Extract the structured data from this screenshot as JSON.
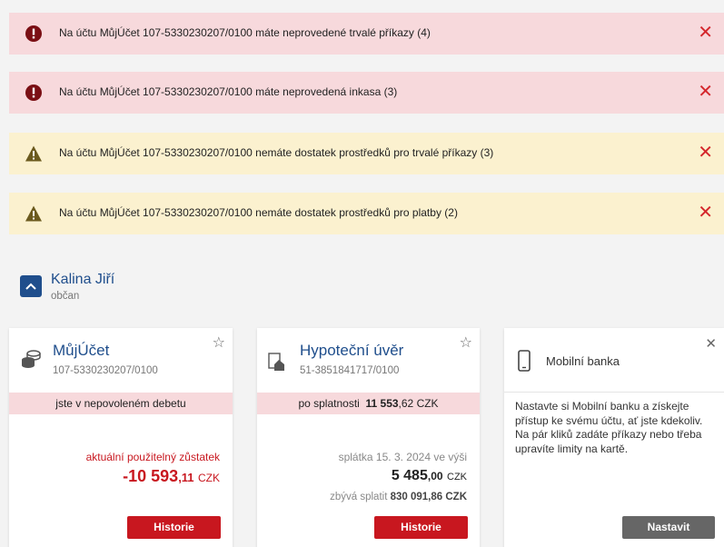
{
  "alerts": [
    {
      "type": "error",
      "text": "Na účtu MůjÚčet 107-5330230207/0100 máte neprovedené trvalé příkazy (4)"
    },
    {
      "type": "error",
      "text": "Na účtu MůjÚčet 107-5330230207/0100 máte neprovedená inkasa (3)"
    },
    {
      "type": "warning",
      "text": "Na účtu MůjÚčet 107-5330230207/0100 nemáte dostatek prostředků pro trvalé příkazy (3)"
    },
    {
      "type": "warning",
      "text": "Na účtu MůjÚčet 107-5330230207/0100 nemáte dostatek prostředků pro platby (2)"
    }
  ],
  "close_symbol": "✕",
  "client": {
    "name": "Kalina Jiří",
    "role": "občan"
  },
  "cards": {
    "account": {
      "title": "MůjÚčet",
      "number": "107-5330230207/0100",
      "band": "jste v nepovoleném debetu",
      "balance_label": "aktuální použitelný zůstatek",
      "balance_main": "-10 593",
      "balance_dec": ",11",
      "currency": "CZK",
      "button": "Historie"
    },
    "mortgage": {
      "title": "Hypoteční úvěr",
      "number": "51-3851841717/0100",
      "band_label": "po splatnosti",
      "band_main": "11 553",
      "band_dec": ",62 CZK",
      "installment_label": "splátka 15. 3. 2024 ve výši",
      "installment_main": "5 485",
      "installment_dec": ",00",
      "currency": "CZK",
      "remaining_label": "zbývá splatit",
      "remaining_value": "830 091,86 CZK",
      "button": "Historie"
    },
    "mobile": {
      "title": "Mobilní banka",
      "text": "Nastavte si Mobilní banku a získejte přístup ke svému účtu, ať jste kdekoliv. Na pár kliků zadáte příkazy nebo třeba upravíte limity na kartě.",
      "button": "Nastavit"
    }
  },
  "colors": {
    "error_bg": "#f7d9dc",
    "warning_bg": "#fbf1cf",
    "brand_blue": "#1f4e8c",
    "accent_red": "#c8171f"
  }
}
